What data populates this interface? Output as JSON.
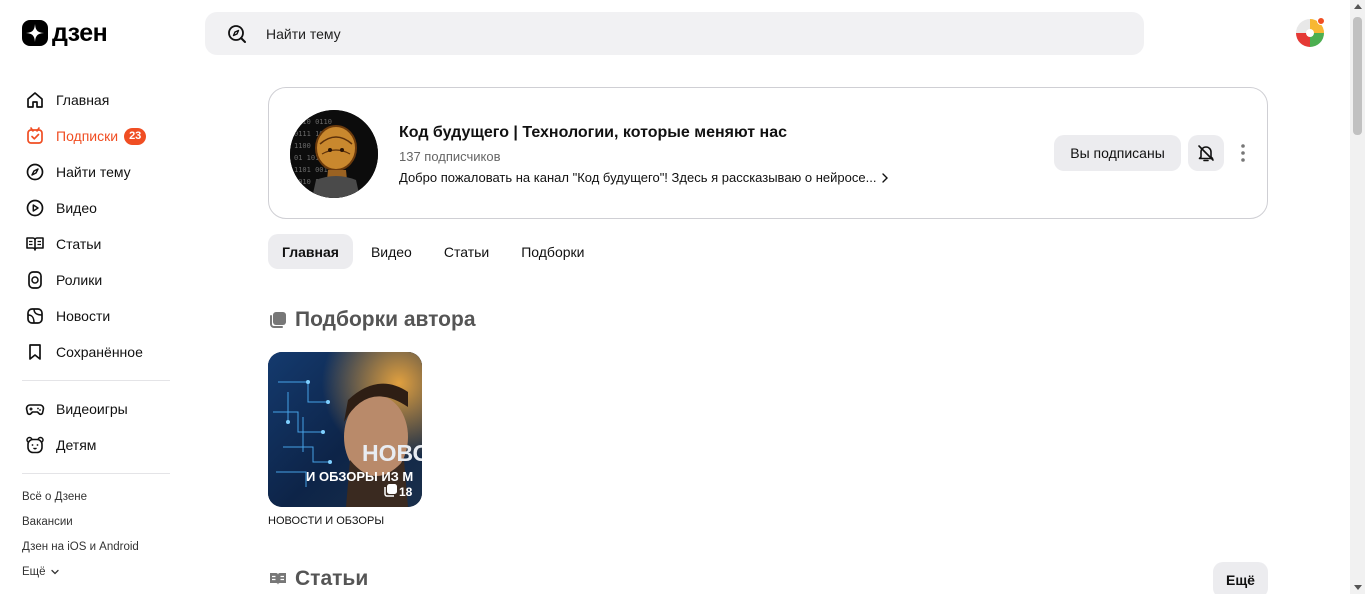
{
  "header": {
    "logo_text": "дзен",
    "search_placeholder": "Найти тему"
  },
  "sidebar": {
    "items": [
      {
        "label": "Главная",
        "icon": "home-icon"
      },
      {
        "label": "Подписки",
        "icon": "subscriptions-icon",
        "badge": "23",
        "active": true
      },
      {
        "label": "Найти тему",
        "icon": "compass-icon"
      },
      {
        "label": "Видео",
        "icon": "video-icon"
      },
      {
        "label": "Статьи",
        "icon": "book-icon"
      },
      {
        "label": "Ролики",
        "icon": "shorts-icon"
      },
      {
        "label": "Новости",
        "icon": "news-icon"
      },
      {
        "label": "Сохранённое",
        "icon": "bookmark-icon"
      }
    ],
    "extra_items": [
      {
        "label": "Видеоигры",
        "icon": "gamepad-icon"
      },
      {
        "label": "Детям",
        "icon": "bear-icon"
      }
    ],
    "footer_links": [
      "Всё о Дзене",
      "Вакансии",
      "Дзен на iOS и Android",
      "Ещё"
    ]
  },
  "channel": {
    "title": "Код будущего | Технологии, которые меняют нас",
    "subscribers": "137 подписчиков",
    "description": "Добро пожаловать на канал \"Код будущего\"! Здесь я рассказываю о нейросе...",
    "subscribed_label": "Вы подписаны"
  },
  "tabs": [
    "Главная",
    "Видео",
    "Статьи",
    "Подборки"
  ],
  "collections_section": {
    "title": "Подборки автора",
    "items": [
      {
        "caption": "НОВОСТИ И ОБЗОРЫ",
        "overlay_title": "НОВО",
        "overlay_subtitle": "И ОБЗОРЫ ИЗ М",
        "count": "18"
      }
    ]
  },
  "articles_section": {
    "title": "Статьи",
    "more_label": "Ещё"
  },
  "colors": {
    "accent": "#f04e23",
    "tab_active_bg": "#ececef",
    "search_bg": "#f1f1f3"
  }
}
